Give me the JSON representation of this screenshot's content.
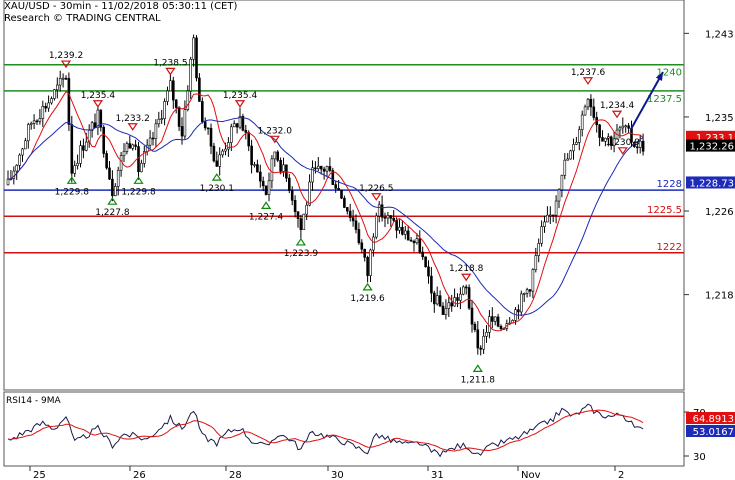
{
  "header": {
    "title": "XAU/USD - 30min - 11/02/2018 05:30:11 (CET)",
    "credit": "Research © TRADING CENTRAL"
  },
  "chart_data": {
    "type": "candlestick",
    "price_axis": {
      "ticks": [
        "1,243",
        "1,235",
        "1,226",
        "1,218"
      ],
      "range": [
        1209,
        1244
      ]
    },
    "date_axis": {
      "labels": [
        "25",
        "26",
        "28",
        "30",
        "31",
        "Nov",
        "2"
      ]
    },
    "horizontal_levels": [
      {
        "label": "1240",
        "value": 1240.0,
        "color": "#1e8e1e"
      },
      {
        "label": "1237.5",
        "value": 1237.5,
        "color": "#1e8e1e"
      },
      {
        "label": "1228",
        "value": 1228.0,
        "color": "#1c2bb8"
      },
      {
        "label": "1225.5",
        "value": 1225.5,
        "color": "#d01010"
      },
      {
        "label": "1222",
        "value": 1222.0,
        "color": "#d01010"
      }
    ],
    "price_badges": [
      {
        "label": "1,233.1",
        "value": 1233.1,
        "color": "#e01010"
      },
      {
        "label": "1,232.26",
        "value": 1232.26,
        "color": "#000000"
      },
      {
        "label": "1,228.73",
        "value": 1228.73,
        "color": "#1c2bb8"
      }
    ],
    "swing_labels": [
      {
        "text": "1,239.2",
        "i": 20,
        "value": 1239.2,
        "kind": "high"
      },
      {
        "text": "1,235.4",
        "i": 31,
        "value": 1235.4,
        "kind": "high"
      },
      {
        "text": "1,233.2",
        "i": 43,
        "value": 1233.2,
        "kind": "high"
      },
      {
        "text": "1,238.5",
        "i": 56,
        "value": 1238.5,
        "kind": "high"
      },
      {
        "text": "1,235.4",
        "i": 80,
        "value": 1235.4,
        "kind": "high"
      },
      {
        "text": "1,232.0",
        "i": 92,
        "value": 1232.0,
        "kind": "high"
      },
      {
        "text": "1,226.5",
        "i": 127,
        "value": 1226.5,
        "kind": "high"
      },
      {
        "text": "1,218.8",
        "i": 158,
        "value": 1218.8,
        "kind": "high"
      },
      {
        "text": "1,237.6",
        "i": 200,
        "value": 1237.6,
        "kind": "high"
      },
      {
        "text": "1,234.4",
        "i": 210,
        "value": 1234.4,
        "kind": "high"
      },
      {
        "text": "1,230.9",
        "i": 212,
        "value": 1230.9,
        "kind": "high"
      },
      {
        "text": "1,229.8",
        "i": 22,
        "value": 1229.8,
        "kind": "low"
      },
      {
        "text": "1,227.8",
        "i": 36,
        "value": 1227.8,
        "kind": "low"
      },
      {
        "text": "1,229.8",
        "i": 45,
        "value": 1229.8,
        "kind": "low"
      },
      {
        "text": "1,230.1",
        "i": 72,
        "value": 1230.1,
        "kind": "low"
      },
      {
        "text": "1,227.4",
        "i": 89,
        "value": 1227.4,
        "kind": "low"
      },
      {
        "text": "1,223.9",
        "i": 101,
        "value": 1223.9,
        "kind": "low"
      },
      {
        "text": "1,219.6",
        "i": 124,
        "value": 1219.6,
        "kind": "low"
      },
      {
        "text": "1,211.8",
        "i": 162,
        "value": 1211.8,
        "kind": "low"
      }
    ],
    "pivots": [
      [
        0,
        1228.5
      ],
      [
        8,
        1234.5
      ],
      [
        14,
        1236.5
      ],
      [
        20,
        1239.0
      ],
      [
        22,
        1230.0
      ],
      [
        27,
        1233.0
      ],
      [
        31,
        1235.0
      ],
      [
        36,
        1228.0
      ],
      [
        40,
        1232.0
      ],
      [
        43,
        1233.0
      ],
      [
        45,
        1230.0
      ],
      [
        50,
        1233.0
      ],
      [
        56,
        1238.0
      ],
      [
        60,
        1233.5
      ],
      [
        64,
        1242.5
      ],
      [
        66,
        1236.0
      ],
      [
        72,
        1230.5
      ],
      [
        76,
        1233.0
      ],
      [
        80,
        1235.0
      ],
      [
        84,
        1231.0
      ],
      [
        89,
        1227.8
      ],
      [
        92,
        1231.8
      ],
      [
        97,
        1228.5
      ],
      [
        101,
        1224.3
      ],
      [
        105,
        1229.5
      ],
      [
        110,
        1230.2
      ],
      [
        115,
        1227.5
      ],
      [
        120,
        1224.5
      ],
      [
        124,
        1220.0
      ],
      [
        127,
        1226.2
      ],
      [
        132,
        1225.0
      ],
      [
        138,
        1223.5
      ],
      [
        142,
        1222.5
      ],
      [
        146,
        1218.0
      ],
      [
        150,
        1216.5
      ],
      [
        154,
        1217.5
      ],
      [
        158,
        1218.5
      ],
      [
        162,
        1212.5
      ],
      [
        166,
        1215.5
      ],
      [
        170,
        1215.0
      ],
      [
        175,
        1216.5
      ],
      [
        180,
        1219.0
      ],
      [
        184,
        1224.0
      ],
      [
        188,
        1226.0
      ],
      [
        191,
        1230.0
      ],
      [
        195,
        1232.0
      ],
      [
        200,
        1237.3
      ],
      [
        204,
        1233.5
      ],
      [
        208,
        1232.8
      ],
      [
        212,
        1234.0
      ],
      [
        216,
        1232.5
      ],
      [
        219,
        1232.3
      ]
    ],
    "forecast_arrow": {
      "from": [
        1233.8
      ],
      "to": [
        1239.3
      ]
    },
    "rsi": {
      "title": "RSI14 - 9MA",
      "ticks": [
        "70",
        "30"
      ],
      "range": [
        25,
        85
      ],
      "rsi_badge": "53.0167",
      "ma_badge": "64.8913",
      "pivots": [
        [
          0,
          44
        ],
        [
          6,
          52
        ],
        [
          12,
          60
        ],
        [
          16,
          55
        ],
        [
          20,
          66
        ],
        [
          23,
          42
        ],
        [
          28,
          50
        ],
        [
          31,
          55
        ],
        [
          36,
          40
        ],
        [
          40,
          50
        ],
        [
          44,
          48
        ],
        [
          48,
          45
        ],
        [
          52,
          55
        ],
        [
          56,
          64
        ],
        [
          60,
          55
        ],
        [
          64,
          72
        ],
        [
          67,
          48
        ],
        [
          72,
          42
        ],
        [
          76,
          52
        ],
        [
          80,
          56
        ],
        [
          84,
          44
        ],
        [
          89,
          38
        ],
        [
          93,
          50
        ],
        [
          97,
          46
        ],
        [
          101,
          36
        ],
        [
          105,
          52
        ],
        [
          110,
          48
        ],
        [
          115,
          44
        ],
        [
          120,
          38
        ],
        [
          124,
          34
        ],
        [
          127,
          50
        ],
        [
          132,
          44
        ],
        [
          138,
          40
        ],
        [
          142,
          42
        ],
        [
          146,
          34
        ],
        [
          150,
          32
        ],
        [
          154,
          38
        ],
        [
          158,
          40
        ],
        [
          162,
          30
        ],
        [
          166,
          38
        ],
        [
          170,
          42
        ],
        [
          175,
          46
        ],
        [
          180,
          52
        ],
        [
          184,
          58
        ],
        [
          188,
          64
        ],
        [
          191,
          72
        ],
        [
          195,
          66
        ],
        [
          200,
          75
        ],
        [
          204,
          68
        ],
        [
          208,
          66
        ],
        [
          212,
          68
        ],
        [
          216,
          56
        ],
        [
          219,
          53
        ]
      ]
    }
  },
  "colors": {
    "candle": "#000000",
    "ma_fast": "#e01010",
    "ma_slow": "#1c2bb8",
    "rsi_line": "#1a1a4a",
    "rsi_ma": "#e01010",
    "arrow": "#0a1a8c"
  }
}
